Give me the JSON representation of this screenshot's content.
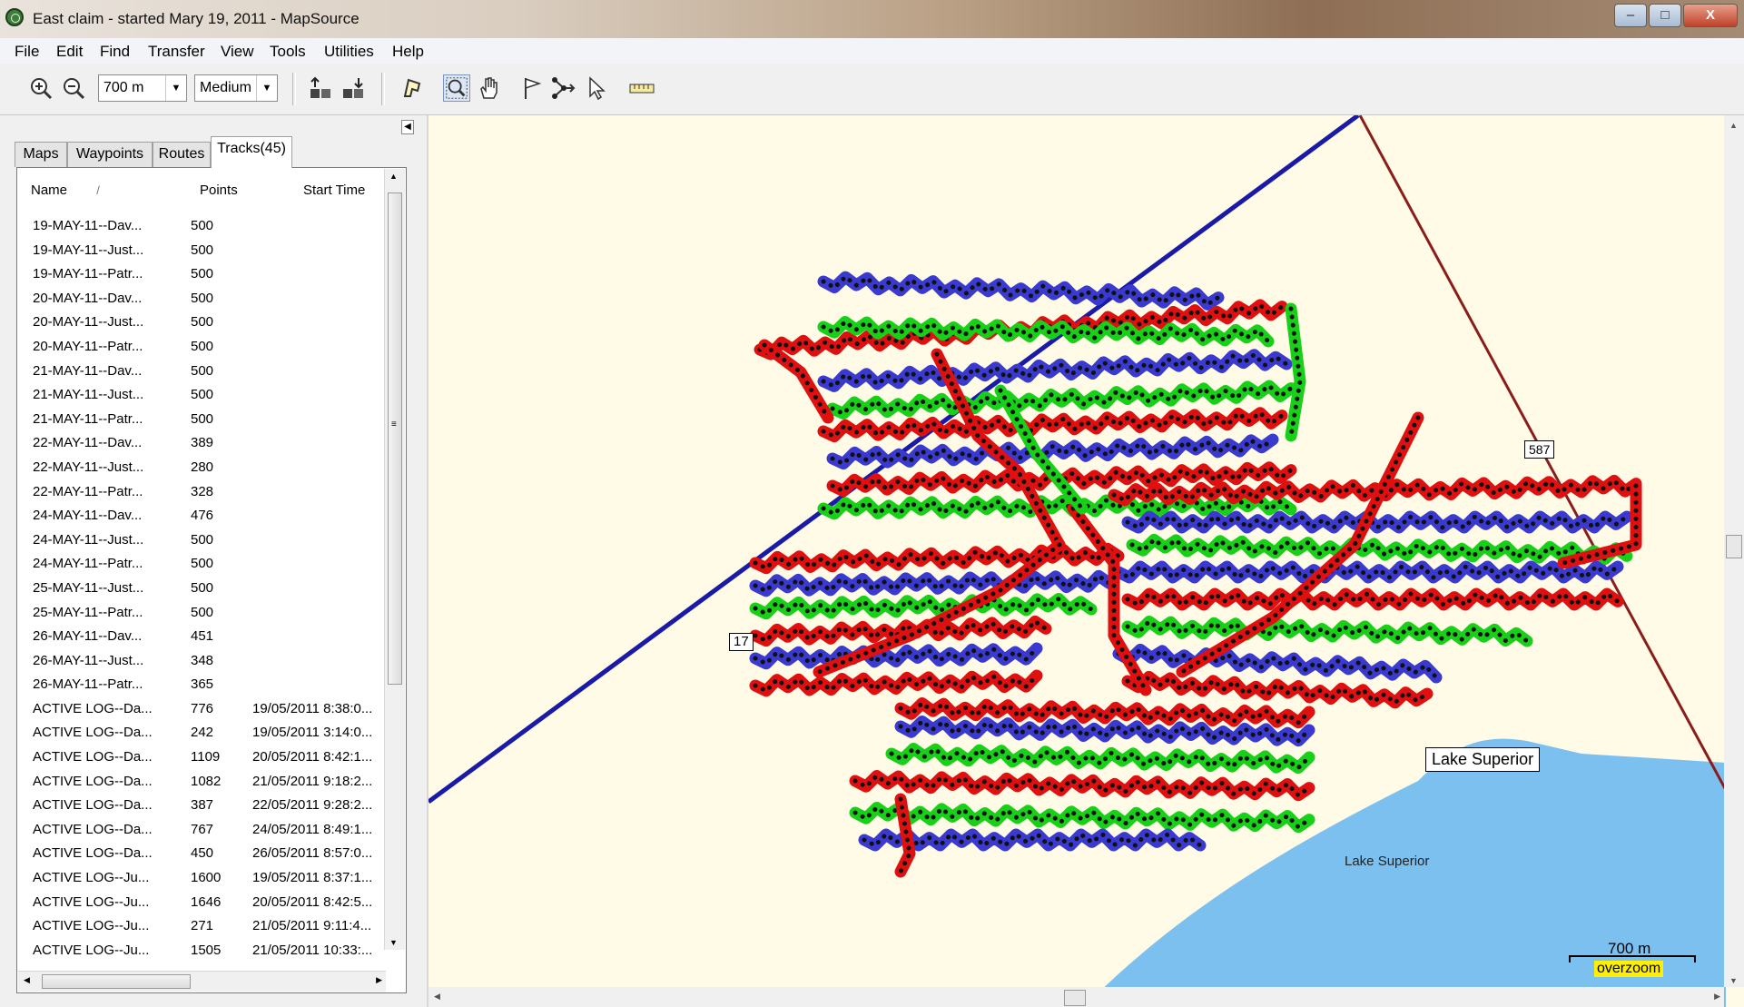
{
  "window": {
    "title": "East claim - started Mary 19, 2011 - MapSource"
  },
  "menu": [
    "File",
    "Edit",
    "Find",
    "Transfer",
    "View",
    "Tools",
    "Utilities",
    "Help"
  ],
  "toolbar": {
    "zoom_value": "700 m",
    "detail_value": "Medium"
  },
  "tabs": [
    "Maps",
    "Waypoints",
    "Routes",
    "Tracks(45)"
  ],
  "list": {
    "columns": {
      "name": "Name",
      "points": "Points",
      "start": "Start Time"
    },
    "rows": [
      {
        "name": "19-MAY-11--Dav...",
        "points": "500",
        "start": ""
      },
      {
        "name": "19-MAY-11--Just...",
        "points": "500",
        "start": ""
      },
      {
        "name": "19-MAY-11--Patr...",
        "points": "500",
        "start": ""
      },
      {
        "name": "20-MAY-11--Dav...",
        "points": "500",
        "start": ""
      },
      {
        "name": "20-MAY-11--Just...",
        "points": "500",
        "start": ""
      },
      {
        "name": "20-MAY-11--Patr...",
        "points": "500",
        "start": ""
      },
      {
        "name": "21-MAY-11--Dav...",
        "points": "500",
        "start": ""
      },
      {
        "name": "21-MAY-11--Just...",
        "points": "500",
        "start": ""
      },
      {
        "name": "21-MAY-11--Patr...",
        "points": "500",
        "start": ""
      },
      {
        "name": "22-MAY-11--Dav...",
        "points": "389",
        "start": ""
      },
      {
        "name": "22-MAY-11--Just...",
        "points": "280",
        "start": ""
      },
      {
        "name": "22-MAY-11--Patr...",
        "points": "328",
        "start": ""
      },
      {
        "name": "24-MAY-11--Dav...",
        "points": "476",
        "start": ""
      },
      {
        "name": "24-MAY-11--Just...",
        "points": "500",
        "start": ""
      },
      {
        "name": "24-MAY-11--Patr...",
        "points": "500",
        "start": ""
      },
      {
        "name": "25-MAY-11--Just...",
        "points": "500",
        "start": ""
      },
      {
        "name": "25-MAY-11--Patr...",
        "points": "500",
        "start": ""
      },
      {
        "name": "26-MAY-11--Dav...",
        "points": "451",
        "start": ""
      },
      {
        "name": "26-MAY-11--Just...",
        "points": "348",
        "start": ""
      },
      {
        "name": "26-MAY-11--Patr...",
        "points": "365",
        "start": ""
      },
      {
        "name": "ACTIVE LOG--Da...",
        "points": "776",
        "start": "19/05/2011 8:38:0..."
      },
      {
        "name": "ACTIVE LOG--Da...",
        "points": "242",
        "start": "19/05/2011 3:14:0..."
      },
      {
        "name": "ACTIVE LOG--Da...",
        "points": "1109",
        "start": "20/05/2011 8:42:1..."
      },
      {
        "name": "ACTIVE LOG--Da...",
        "points": "1082",
        "start": "21/05/2011 9:18:2..."
      },
      {
        "name": "ACTIVE LOG--Da...",
        "points": "387",
        "start": "22/05/2011 9:28:2..."
      },
      {
        "name": "ACTIVE LOG--Da...",
        "points": "767",
        "start": "24/05/2011 8:49:1..."
      },
      {
        "name": "ACTIVE LOG--Da...",
        "points": "450",
        "start": "26/05/2011 8:57:0..."
      },
      {
        "name": "ACTIVE LOG--Ju...",
        "points": "1600",
        "start": "19/05/2011 8:37:1..."
      },
      {
        "name": "ACTIVE LOG--Ju...",
        "points": "1646",
        "start": "20/05/2011 8:42:5..."
      },
      {
        "name": "ACTIVE LOG--Ju...",
        "points": "271",
        "start": "21/05/2011 9:11:4..."
      },
      {
        "name": "ACTIVE LOG--Ju...",
        "points": "1505",
        "start": "21/05/2011 10:33:..."
      }
    ]
  },
  "map": {
    "road_labels": [
      "17",
      "587"
    ],
    "lake_box_label": "Lake Superior",
    "lake_label": "Lake Superior",
    "scale_label": "700 m",
    "overzoom_label": "overzoom",
    "colors": {
      "track_red": "#e01010",
      "track_blue": "#3a3ad0",
      "track_green": "#18d018",
      "road_blue": "#1a1aa8",
      "road_brown": "#8b1c1c",
      "lake": "#7cc0f0",
      "land": "#fffbe6"
    }
  }
}
